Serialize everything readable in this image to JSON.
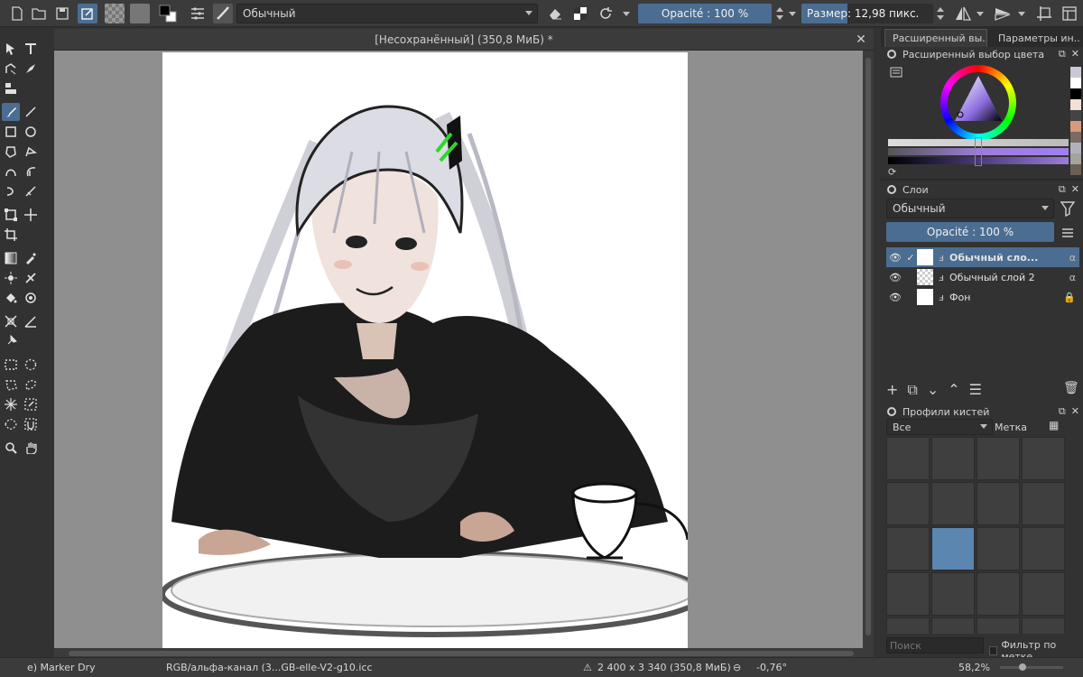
{
  "toolbar": {
    "blend_mode": "Обычный",
    "opacity_label": "Opacité : 100 %",
    "size_label": "Размер: 12,98 пикс.",
    "fg_color": "#000000",
    "bg_color": "#ffffff"
  },
  "document": {
    "title": "[Несохранённый]  (350,8 МиБ) *",
    "close_glyph": "✕"
  },
  "right": {
    "tabs": [
      {
        "label": "Расширенный вы..."
      },
      {
        "label": "Параметры ин..."
      }
    ],
    "color_panel_title": "Расширенный выбор цвета",
    "layers_panel_title": "Слои",
    "layers_blend": "Обычный",
    "layers_opacity": "Opacité : 100 %",
    "layers": [
      {
        "name": "Обычный сло...",
        "selected": true,
        "checked": true
      },
      {
        "name": "Обычный слой 2",
        "selected": false,
        "checked": false
      },
      {
        "name": "Фон",
        "selected": false,
        "checked": false,
        "locked": true
      }
    ],
    "brushes_panel_title": "Профили кистей",
    "brushes_filter": "Все",
    "brushes_tag_label": "Метка",
    "search_placeholder": "Поиск",
    "filter_by_tag": "Фильтр по метке",
    "color_swatches": [
      "#c9c9d6",
      "#ffffff",
      "#000000",
      "#f3e0d6",
      "#444444",
      "#d89a7c",
      "#7a6a63",
      "#b2b0b8",
      "#a4a49c",
      "#6a5f54"
    ]
  },
  "status": {
    "brush": "e) Marker Dry",
    "color_space": "RGB/альфа-канал (3...GB-elle-V2-g10.icc",
    "dimensions": "2 400 x 3 340 (350,8 МиБ)",
    "rotation": "-0,76°",
    "zoom": "58,2%"
  }
}
